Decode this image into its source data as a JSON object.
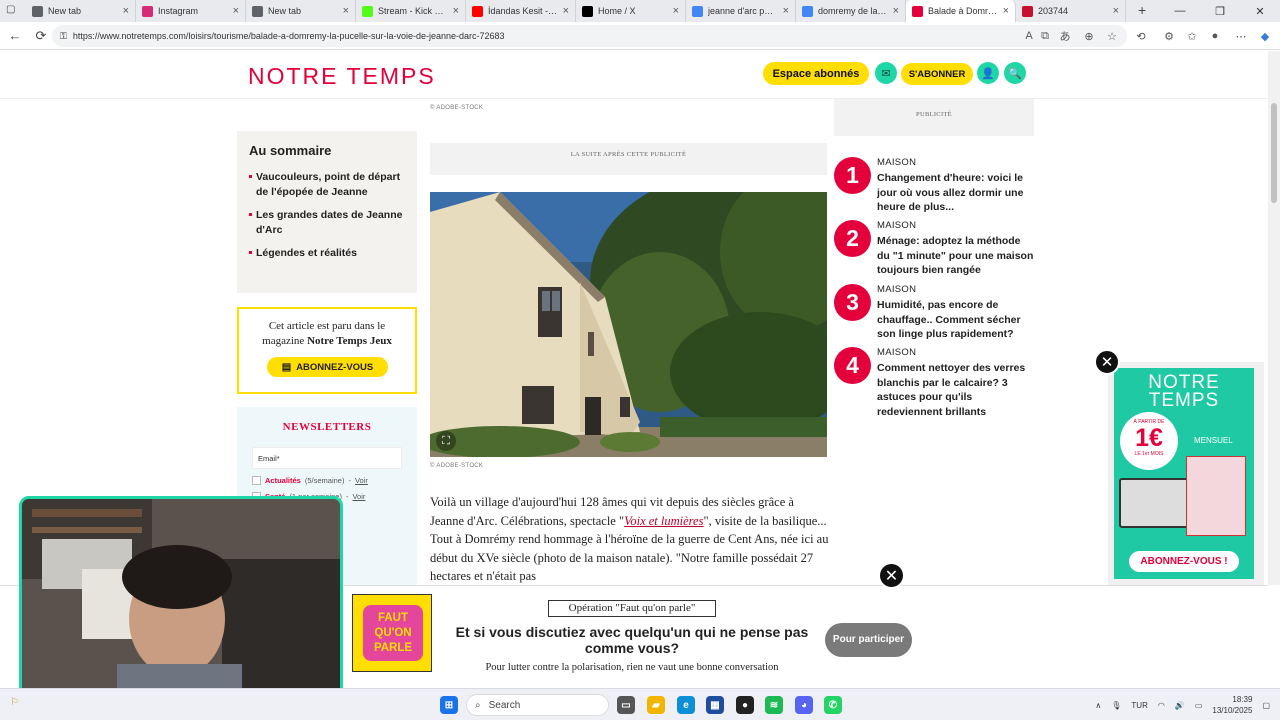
{
  "browser": {
    "tabs": [
      {
        "title": "New tab",
        "icon": "newtab-icon",
        "color": "#5f6368"
      },
      {
        "title": "Instagram",
        "icon": "instagram-icon",
        "color": "#d62976"
      },
      {
        "title": "New tab",
        "icon": "newtab-icon",
        "color": "#5f6368"
      },
      {
        "title": "Stream - Kick Dashb",
        "icon": "kick-icon",
        "color": "#53fc18"
      },
      {
        "title": "İdandas Kesit - You",
        "icon": "youtube-icon",
        "color": "#ff0000"
      },
      {
        "title": "Home / X",
        "icon": "x-icon",
        "color": "#000000"
      },
      {
        "title": "jeanne d'arc portra",
        "icon": "google-icon",
        "color": "#4285f4"
      },
      {
        "title": "domremy de la puc",
        "icon": "google-icon",
        "color": "#4285f4"
      },
      {
        "title": "Balade à Domrémy",
        "icon": "notretemps-icon",
        "color": "#e4003a"
      },
      {
        "title": "203744",
        "icon": "dp-icon",
        "color": "#c8102e"
      }
    ],
    "url": "https://www.notretemps.com/loisirs/tourisme/balade-a-domremy-la-pucelle-sur-la-voie-de-jeanne-darc-72683"
  },
  "site": {
    "logo": "NOTRE TEMPS",
    "espace_abonnes": "Espace abonnés",
    "sabonner": "S'ABONNER"
  },
  "sommaire": {
    "title": "Au sommaire",
    "items": [
      "Vaucouleurs, point de départ de l'épopée de Jeanne",
      "Les grandes dates de Jeanne d'Arc",
      "Légendes et réalités"
    ]
  },
  "magazine_box": {
    "line1": "Cet article est paru dans le",
    "line2_prefix": "magazine ",
    "magazine_name": "Notre Temps Jeux",
    "button": "ABONNEZ-VOUS"
  },
  "newsletters": {
    "title": "NEWSLETTERS",
    "email_placeholder": "Email*",
    "items": [
      {
        "name": "Actualités",
        "freq": "(5/semaine)",
        "link": "Voir"
      },
      {
        "name": "Santé",
        "freq": "(1 par semaine)",
        "link": "Voir"
      }
    ]
  },
  "article": {
    "credit_top": "© ADOBE-STOCK",
    "ad_label": "LA SUITE APRÈS CETTE PUBLICITÉ",
    "photo_credit": "© ADOBE-STOCK",
    "p1_before": "Voilà un village d'aujourd'hui 128 âmes qui vit depuis des siècles grâce à Jeanne d'Arc. Célébrations, spectacle \"",
    "p1_link": "Voix et lumières",
    "p1_after": "\", visite de la basilique... Tout à Domrémy rend hommage à l'héroïne de la guerre de Cent Ans, née ici au début du XVe siècle (photo de la maison natale). \"Notre famille possédait 27 hectares et n'était pas"
  },
  "right_column": {
    "pub_label": "PUBLICITÉ",
    "ranking": [
      {
        "num": "1",
        "category": "MAISON",
        "title": "Changement d'heure: voici le jour où vous allez dormir une heure de plus..."
      },
      {
        "num": "2",
        "category": "MAISON",
        "title": "Ménage: adoptez la méthode du \"1 minute\" pour une maison toujours bien rangée"
      },
      {
        "num": "3",
        "category": "MAISON",
        "title": "Humidité, pas encore de chauffage.. Comment sécher son linge plus rapidement?"
      },
      {
        "num": "4",
        "category": "MAISON",
        "title": "Comment nettoyer des verres blanchis par le calcaire? 3 astuces pour qu'ils redeviennent brillants"
      }
    ]
  },
  "float_ad": {
    "logo": "NOTRE TEMPS",
    "price_prefix": "À PARTIR DE",
    "price": "1€",
    "price_suffix": "LE 1er MOIS",
    "badge": "MENSUEL",
    "cta": "ABONNEZ-VOUS !"
  },
  "bottom_banner": {
    "logo_lines": [
      "FAUT",
      "QU'ON",
      "PARLE"
    ],
    "operation": "Opération \"Faut qu'on parle\"",
    "headline": "Et si vous discutiez avec quelqu'un qui ne pense pas comme vous?",
    "sub": "Pour lutter contre la polarisation, rien ne vaut une bonne conversation",
    "cta": "Pour participer"
  },
  "taskbar": {
    "search": "Search",
    "lang": "TUR",
    "time": "18:39",
    "date": "13/10/2025"
  },
  "colors": {
    "brand_red": "#e4003a",
    "brand_yellow": "#ffde00",
    "brand_teal": "#1fd7a6"
  }
}
